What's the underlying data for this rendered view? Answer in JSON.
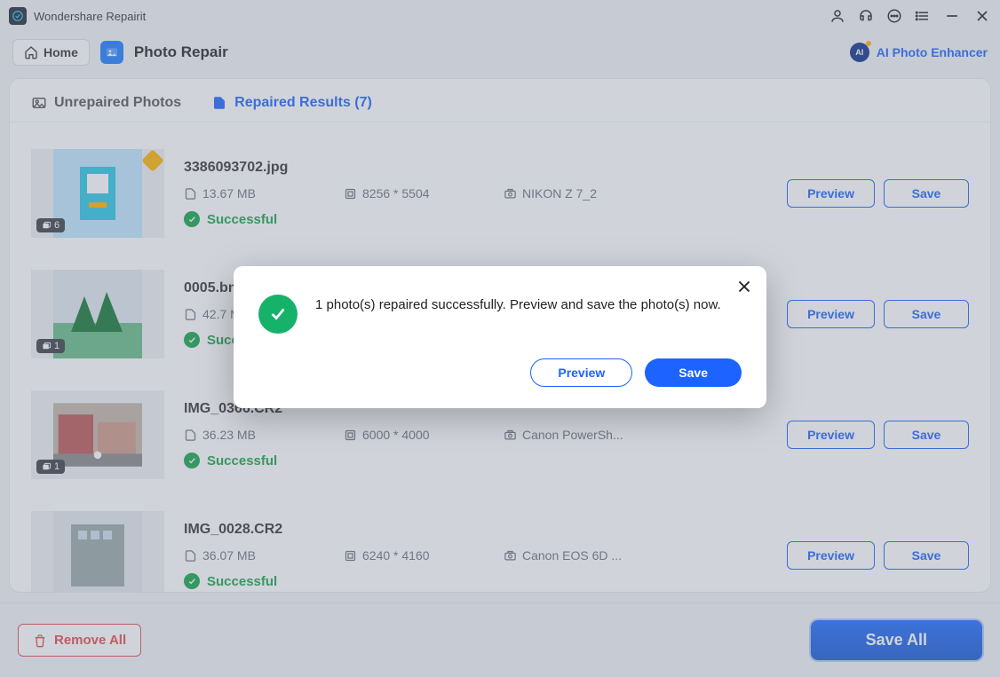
{
  "app": {
    "title": "Wondershare Repairit"
  },
  "toolbar": {
    "home": "Home",
    "module": "Photo Repair",
    "ai_link": "AI Photo Enhancer",
    "ai_badge": "AI"
  },
  "tabs": {
    "unrepaired": "Unrepaired Photos",
    "repaired": "Repaired Results (7)"
  },
  "items": [
    {
      "name": "3386093702.jpg",
      "size": "13.67 MB",
      "dims": "8256 * 5504",
      "camera": "NIKON Z 7_2",
      "status": "Successful",
      "count": "6",
      "flag": true
    },
    {
      "name": "0005.bmp",
      "size": "42.7 MB",
      "dims": "",
      "camera": "",
      "status": "Successful",
      "count": "1",
      "flag": false
    },
    {
      "name": "IMG_0366.CR2",
      "size": "36.23 MB",
      "dims": "6000 * 4000",
      "camera": "Canon PowerSh...",
      "status": "Successful",
      "count": "1",
      "flag": false
    },
    {
      "name": "IMG_0028.CR2",
      "size": "36.07 MB",
      "dims": "6240 * 4160",
      "camera": "Canon EOS 6D ...",
      "status": "Successful",
      "count": "",
      "flag": false
    }
  ],
  "row_buttons": {
    "preview": "Preview",
    "save": "Save"
  },
  "footer": {
    "remove_all": "Remove All",
    "save_all": "Save All"
  },
  "modal": {
    "message": "1 photo(s) repaired successfully. Preview and save the photo(s) now.",
    "preview": "Preview",
    "save": "Save"
  }
}
